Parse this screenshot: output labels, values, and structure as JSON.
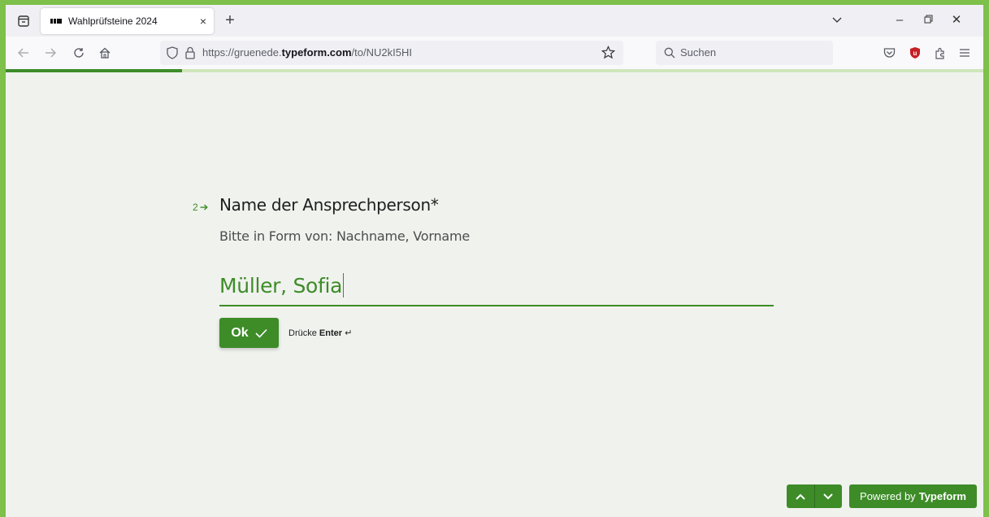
{
  "browser": {
    "tab": {
      "title": "Wahlprüfsteine 2024",
      "close": "×"
    },
    "new_tab": "+",
    "list_all_tabs": "⌄",
    "window_controls": {
      "minimize": "–",
      "restore": "❐",
      "close": "✕"
    },
    "url": {
      "prefix": "https://gruenede.",
      "domain": "typeform.com",
      "path": "/to/NU2kI5HI"
    },
    "search_placeholder": "Suchen",
    "icons": [
      "back-icon",
      "forward-icon",
      "reload-icon",
      "home-icon",
      "shield-icon",
      "lock-icon",
      "bookmark-star-icon",
      "search-icon",
      "pocket-icon",
      "ublock-icon",
      "extensions-icon",
      "menu-icon"
    ]
  },
  "form": {
    "progress": 0.18,
    "question_number": "2",
    "question_title": "Name der Ansprechperson*",
    "question_description": "Bitte in Form von: Nachname, Vorname",
    "answer_value": "Müller, Sofia",
    "ok_label": "Ok",
    "hint_prefix": "Drücke",
    "hint_key": "Enter",
    "hint_symbol": "↵"
  },
  "footer": {
    "powered_prefix": "Powered by",
    "powered_brand": "Typeform"
  },
  "colors": {
    "frame": "#7dc04a",
    "accent": "#3d8c28",
    "background": "#f0f2ee"
  }
}
